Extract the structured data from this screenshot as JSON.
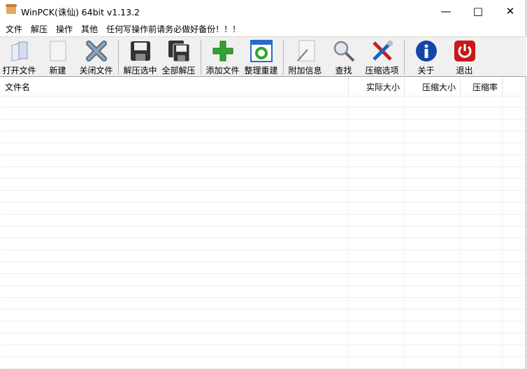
{
  "window": {
    "title": "WinPCK(诛仙) 64bit v1.13.2"
  },
  "menu": [
    "文件",
    "解压",
    "操作",
    "其他",
    "任何写操作前请务必做好备份！！！"
  ],
  "toolbar": [
    {
      "label": "打开文件",
      "icon": "open-file-icon"
    },
    {
      "label": "新建",
      "icon": "new-file-icon"
    },
    {
      "label": "关闭文件",
      "icon": "close-file-icon"
    },
    {
      "label": "解压选中",
      "icon": "extract-selected-icon"
    },
    {
      "label": "全部解压",
      "icon": "extract-all-icon"
    },
    {
      "label": "添加文件",
      "icon": "add-file-icon"
    },
    {
      "label": "整理重建",
      "icon": "rebuild-icon"
    },
    {
      "label": "附加信息",
      "icon": "comment-icon"
    },
    {
      "label": "查找",
      "icon": "search-icon"
    },
    {
      "label": "压缩选项",
      "icon": "tools-icon"
    },
    {
      "label": "关于",
      "icon": "info-icon"
    },
    {
      "label": "退出",
      "icon": "power-icon"
    }
  ],
  "columns": [
    "文件名",
    "实际大小",
    "压缩大小",
    "压缩率"
  ]
}
